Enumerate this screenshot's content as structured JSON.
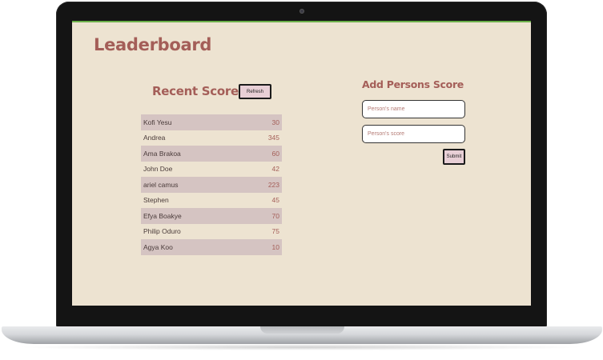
{
  "app": {
    "title": "Leaderboard"
  },
  "recent_scores": {
    "heading": "Recent Scores",
    "refresh_label": "Refresh",
    "rows": [
      {
        "name": "Kofi Yesu",
        "score": "30"
      },
      {
        "name": "Andrea",
        "score": "345"
      },
      {
        "name": "Ama Brakoa",
        "score": "60"
      },
      {
        "name": "John Doe",
        "score": "42"
      },
      {
        "name": "ariel camus",
        "score": "223"
      },
      {
        "name": "Stephen",
        "score": "45"
      },
      {
        "name": "Efya Boakye",
        "score": "70"
      },
      {
        "name": "Philip Oduro",
        "score": "75"
      },
      {
        "name": "Agya Koo",
        "score": "10"
      }
    ]
  },
  "add_score": {
    "heading": "Add Persons Score",
    "name_placeholder": "Person's name",
    "score_placeholder": "Person's score",
    "submit_label": "Submit"
  },
  "colors": {
    "accent": "#a45e58",
    "background": "#ede3d1",
    "row_alt": "#d5c4c2",
    "button_fill": "#e8cfd6"
  }
}
